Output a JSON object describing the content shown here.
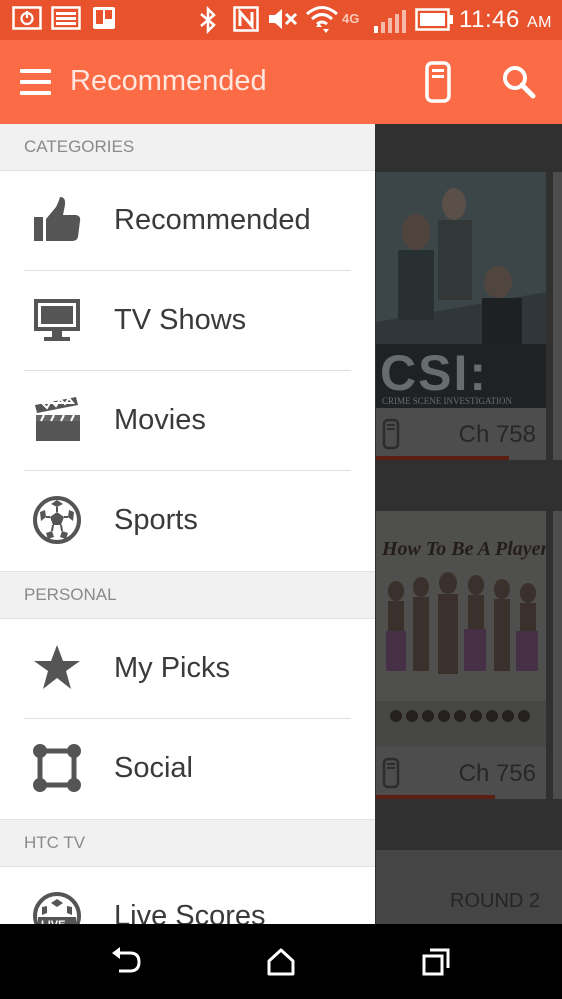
{
  "status_bar": {
    "time": "11:46",
    "ampm": "AM",
    "network": "4G",
    "icons": [
      "power-icon",
      "image-icon",
      "trello-icon",
      "bluetooth-icon",
      "nfc-icon",
      "mute-icon",
      "wifi-icon",
      "signal-icon",
      "battery-icon"
    ]
  },
  "app_bar": {
    "title": "Recommended",
    "icons": [
      "menu-icon",
      "remote-icon",
      "search-icon"
    ]
  },
  "drawer": {
    "sections": [
      {
        "header": "CATEGORIES",
        "items": [
          {
            "label": "Recommended",
            "icon": "thumbs-up-icon"
          },
          {
            "label": "TV Shows",
            "icon": "tv-icon"
          },
          {
            "label": "Movies",
            "icon": "clapperboard-icon"
          },
          {
            "label": "Sports",
            "icon": "soccer-ball-icon"
          }
        ]
      },
      {
        "header": "PERSONAL",
        "items": [
          {
            "label": "My Picks",
            "icon": "star-icon"
          },
          {
            "label": "Social",
            "icon": "social-network-icon"
          }
        ]
      },
      {
        "header": "HTC TV",
        "items": [
          {
            "label": "Live Scores",
            "icon": "live-ball-icon"
          }
        ]
      }
    ]
  },
  "content": {
    "cards": [
      {
        "title_art": "CSI:",
        "subtitle_art": "CRIME SCENE INVESTIGATION",
        "channel": "Ch 758",
        "progress": 0.78
      },
      {
        "title_art": "How To Be A Player",
        "channel": "Ch 756",
        "progress": 0.7
      }
    ],
    "round_label": "ROUND 2"
  },
  "nav_bar": {
    "icons": [
      "back-icon",
      "home-icon",
      "recent-apps-icon"
    ]
  },
  "colors": {
    "status_bar": "#e8532e",
    "app_bar": "#fb6b45",
    "accent_bar": "#8a2e1c"
  }
}
